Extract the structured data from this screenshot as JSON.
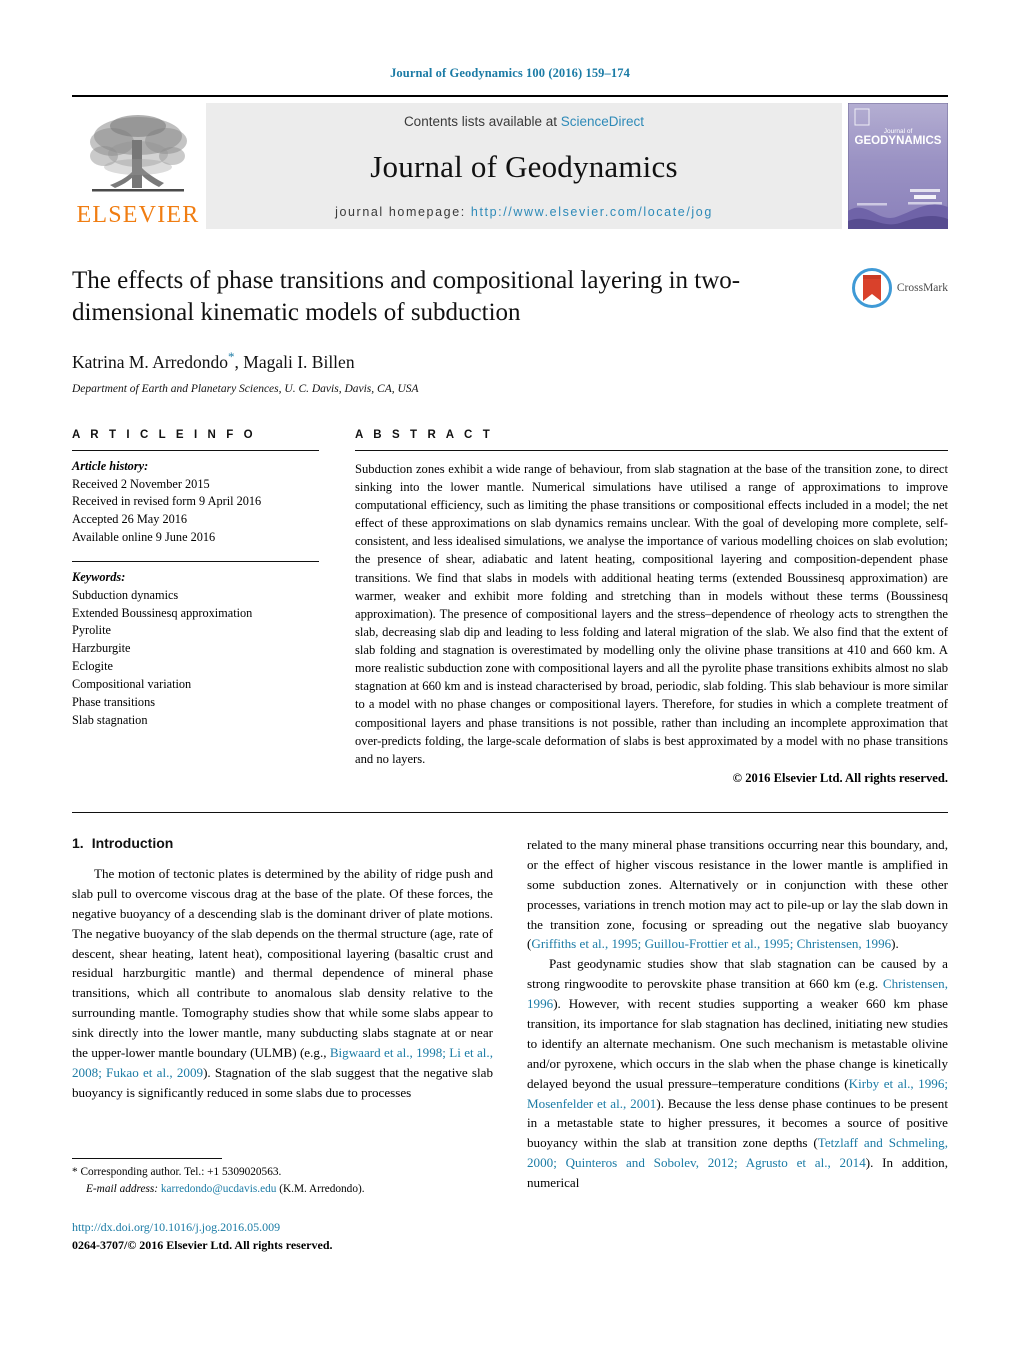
{
  "running_head": "Journal of Geodynamics 100 (2016) 159–174",
  "masthead": {
    "publisher_word": "ELSEVIER",
    "contents_prefix": "Contents lists available at ",
    "contents_link": "ScienceDirect",
    "journal_name": "Journal of Geodynamics",
    "homepage_prefix": "journal homepage: ",
    "homepage_url": "http://www.elsevier.com/locate/jog",
    "cover_line1": "Journal of",
    "cover_line2": "GEODYNAMICS"
  },
  "article": {
    "title": "The effects of phase transitions and compositional layering in two-dimensional kinematic models of subduction",
    "authors": "Katrina M. Arredondo",
    "authors_rest": ", Magali I. Billen",
    "corresponding_marker": "*",
    "affiliation": "Department of Earth and Planetary Sciences, U. C. Davis, Davis, CA, USA",
    "crossmark_label": "CrossMark"
  },
  "article_info": {
    "heading": "A R T I C L E   I N F O",
    "history_label": "Article history:",
    "history": [
      "Received 2 November 2015",
      "Received in revised form 9 April 2016",
      "Accepted 26 May 2016",
      "Available online 9 June 2016"
    ],
    "keywords_label": "Keywords:",
    "keywords": [
      "Subduction dynamics",
      "Extended Boussinesq approximation",
      "Pyrolite",
      "Harzburgite",
      "Eclogite",
      "Compositional variation",
      "Phase transitions",
      "Slab stagnation"
    ]
  },
  "abstract": {
    "heading": "A B S T R A C T",
    "text": "Subduction zones exhibit a wide range of behaviour, from slab stagnation at the base of the transition zone, to direct sinking into the lower mantle. Numerical simulations have utilised a range of approximations to improve computational efficiency, such as limiting the phase transitions or compositional effects included in a model; the net effect of these approximations on slab dynamics remains unclear. With the goal of developing more complete, self-consistent, and less idealised simulations, we analyse the importance of various modelling choices on slab evolution; the presence of shear, adiabatic and latent heating, compositional layering and composition-dependent phase transitions. We find that slabs in models with additional heating terms (extended Boussinesq approximation) are warmer, weaker and exhibit more folding and stretching than in models without these terms (Boussinesq approximation). The presence of compositional layers and the stress–dependence of rheology acts to strengthen the slab, decreasing slab dip and leading to less folding and lateral migration of the slab. We also find that the extent of slab folding and stagnation is overestimated by modelling only the olivine phase transitions at 410 and 660 km. A more realistic subduction zone with compositional layers and all the pyrolite phase transitions exhibits almost no slab stagnation at 660 km and is instead characterised by broad, periodic, slab folding. This slab behaviour is more similar to a model with no phase changes or compositional layers. Therefore, for studies in which a complete treatment of compositional layers and phase transitions is not possible, rather than including an incomplete approximation that over-predicts folding, the large-scale deformation of slabs is best approximated by a model with no phase transitions and no layers.",
    "copyright": "© 2016 Elsevier Ltd. All rights reserved."
  },
  "introduction": {
    "number": "1.",
    "title": "Introduction",
    "left_p1_a": "The motion of tectonic plates is determined by the ability of ridge push and slab pull to overcome viscous drag at the base of the plate. Of these forces, the negative buoyancy of a descending slab is the dominant driver of plate motions. The negative buoyancy of the slab depends on the thermal structure (age, rate of descent, shear heating, latent heat), compositional layering (basaltic crust and residual harzburgitic mantle) and thermal dependence of mineral phase transitions, which all contribute to anomalous slab density relative to the surrounding mantle. Tomography studies show that while some slabs appear to sink directly into the lower mantle, many subducting slabs stagnate at or near the upper-lower mantle boundary (ULMB) (e.g., ",
    "left_cite1": "Bigwaard et al., 1998; Li et al., 2008; Fukao et al., 2009",
    "left_p1_b": "). Stagnation of the slab suggest that the negative slab buoyancy is significantly reduced in some slabs due to processes",
    "right_p1_a": "related to the many mineral phase transitions occurring near this boundary, and, or the effect of higher viscous resistance in the lower mantle is amplified in some subduction zones. Alternatively or in conjunction with these other processes, variations in trench motion may act to pile-up or lay the slab down in the transition zone, focusing or spreading out the negative slab buoyancy (",
    "right_cite1": "Griffiths et al., 1995; Guillou-Frottier et al., 1995; Christensen, 1996",
    "right_p1_b": ").",
    "right_p2_a": "Past geodynamic studies show that slab stagnation can be caused by a strong ringwoodite to perovskite phase transition at 660 km (e.g. ",
    "right_cite2": "Christensen, 1996",
    "right_p2_b": "). However, with recent studies supporting a weaker 660 km phase transition, its importance for slab stagnation has declined, initiating new studies to identify an alternate mechanism. One such mechanism is metastable olivine and/or pyroxene, which occurs in the slab when the phase change is kinetically delayed beyond the usual pressure–temperature conditions (",
    "right_cite3": "Kirby et al., 1996; Mosenfelder et al., 2001",
    "right_p2_c": "). Because the less dense phase continues to be present in a metastable state to higher pressures, it becomes a source of positive buoyancy within the slab at transition zone depths (",
    "right_cite4": "Tetzlaff and Schmeling, 2000; Quinteros and Sobolev, 2012; Agrusto et al., 2014",
    "right_p2_d": "). In addition, numerical"
  },
  "footer": {
    "corresponding": "* Corresponding author. Tel.: +1 5309020563.",
    "email_label": "E-mail address:",
    "email": "karredondo@ucdavis.edu",
    "email_suffix": " (K.M. Arredondo).",
    "doi": "http://dx.doi.org/10.1016/j.jog.2016.05.009",
    "issn_line": "0264-3707/© 2016 Elsevier Ltd. All rights reserved."
  },
  "colors": {
    "link": "#1b7ba5",
    "elsevier_orange": "#f07d12",
    "masthead_bg": "#ececec"
  }
}
